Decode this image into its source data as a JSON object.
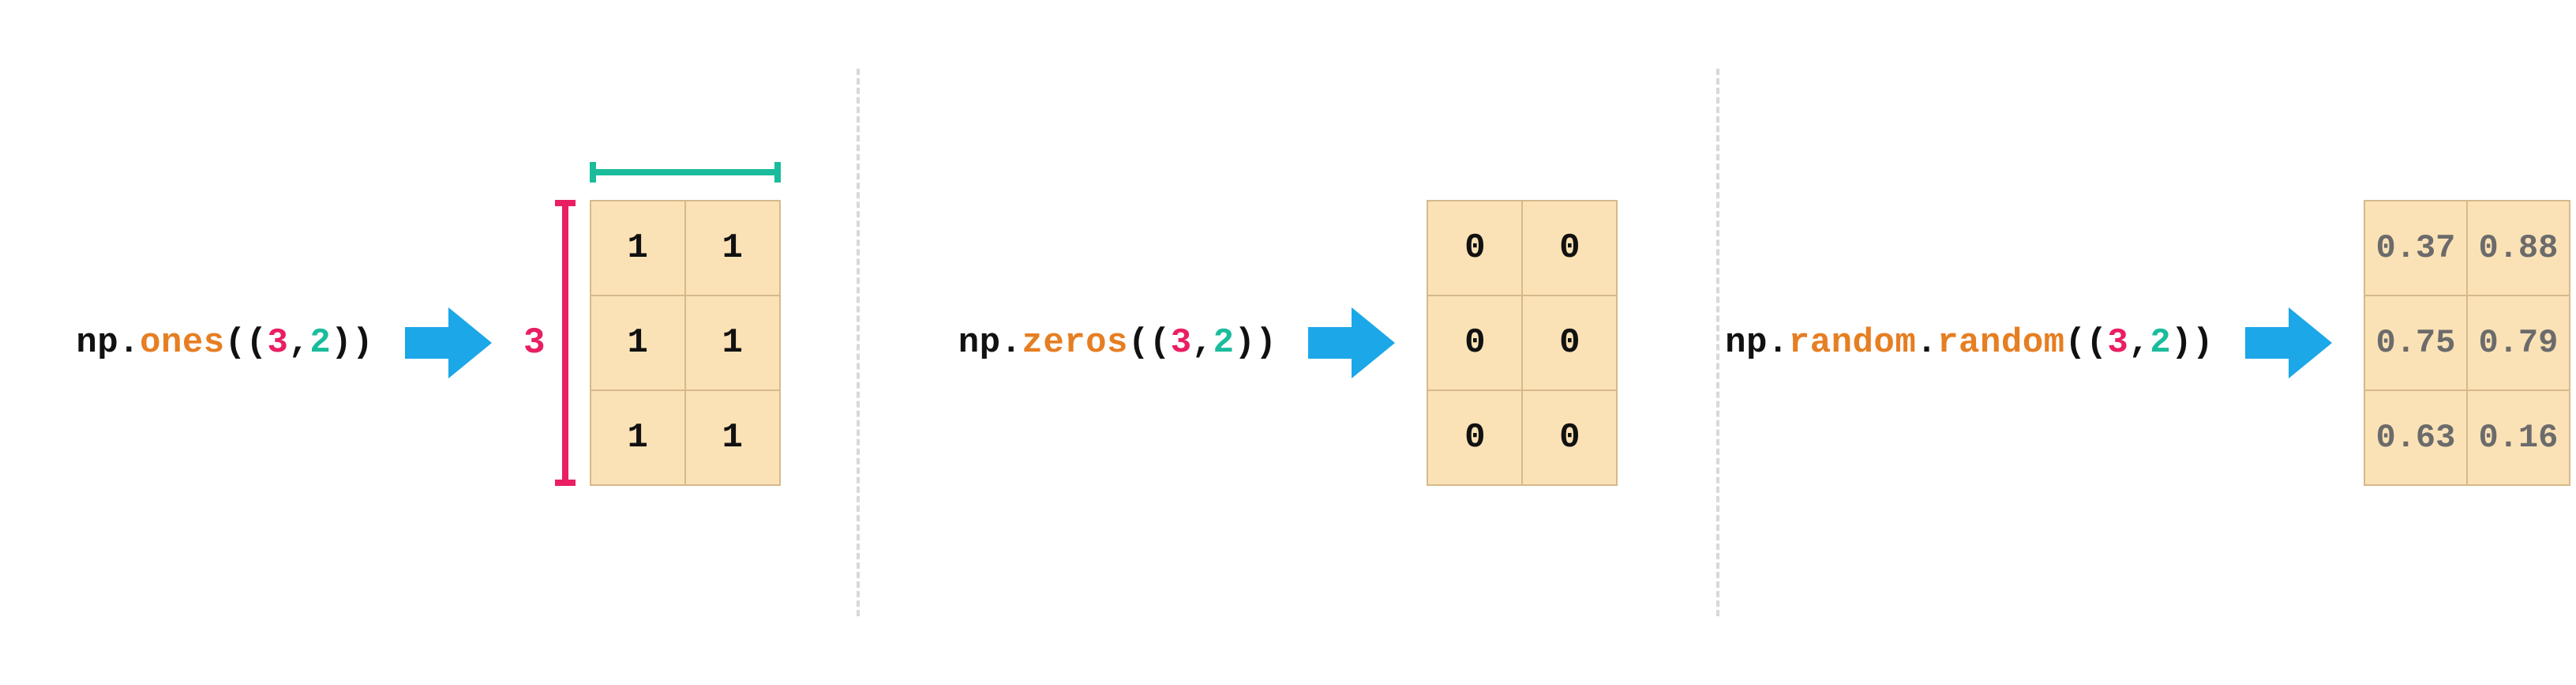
{
  "panels": {
    "ones": {
      "code": {
        "np": "np",
        "dot1": ".",
        "func": "ones",
        "paren_open": "((",
        "rows": "3",
        "comma": ",",
        "cols": "2",
        "paren_close": "))"
      },
      "row_label": "3",
      "matrix": [
        [
          "1",
          "1"
        ],
        [
          "1",
          "1"
        ],
        [
          "1",
          "1"
        ]
      ]
    },
    "zeros": {
      "code": {
        "np": "np",
        "dot1": ".",
        "func": "zeros",
        "paren_open": "((",
        "rows": "3",
        "comma": ",",
        "cols": "2",
        "paren_close": "))"
      },
      "matrix": [
        [
          "0",
          "0"
        ],
        [
          "0",
          "0"
        ],
        [
          "0",
          "0"
        ]
      ]
    },
    "random": {
      "code": {
        "np": "np",
        "dot1": ".",
        "mod": "random",
        "dot2": ".",
        "func": "random",
        "paren_open": "((",
        "rows": "3",
        "comma": ",",
        "cols": "2",
        "paren_close": "))"
      },
      "matrix": [
        [
          "0.37",
          "0.88"
        ],
        [
          "0.75",
          "0.79"
        ],
        [
          "0.63",
          "0.16"
        ]
      ]
    }
  },
  "colors": {
    "func": "#e67e22",
    "rows": "#e91e63",
    "cols": "#1abc9c",
    "arrow": "#1ba7e8",
    "cell_bg": "#fbe2b6",
    "cell_border": "#d6b98b"
  }
}
